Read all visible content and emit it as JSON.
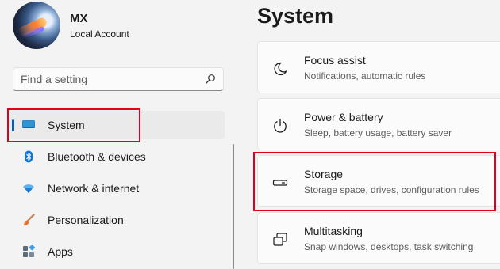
{
  "user": {
    "name": "MX",
    "account": "Local Account"
  },
  "search": {
    "placeholder": "Find a setting"
  },
  "sidebar": {
    "items": [
      {
        "label": "System",
        "icon": "system-icon",
        "selected": true
      },
      {
        "label": "Bluetooth & devices",
        "icon": "bluetooth-icon"
      },
      {
        "label": "Network & internet",
        "icon": "wifi-icon"
      },
      {
        "label": "Personalization",
        "icon": "brush-icon"
      },
      {
        "label": "Apps",
        "icon": "apps-icon"
      }
    ]
  },
  "main": {
    "title": "System",
    "cards": [
      {
        "title": "Focus assist",
        "subtitle": "Notifications, automatic rules",
        "icon": "moon-icon"
      },
      {
        "title": "Power & battery",
        "subtitle": "Sleep, battery usage, battery saver",
        "icon": "power-icon"
      },
      {
        "title": "Storage",
        "subtitle": "Storage space, drives, configuration rules",
        "icon": "storage-icon"
      },
      {
        "title": "Multitasking",
        "subtitle": "Snap windows, desktops, task switching",
        "icon": "multitasking-icon"
      }
    ]
  },
  "colors": {
    "accent": "#005fb8",
    "highlight": "#e0001b",
    "background": "#f3f3f3",
    "card": "#fbfbfb"
  }
}
